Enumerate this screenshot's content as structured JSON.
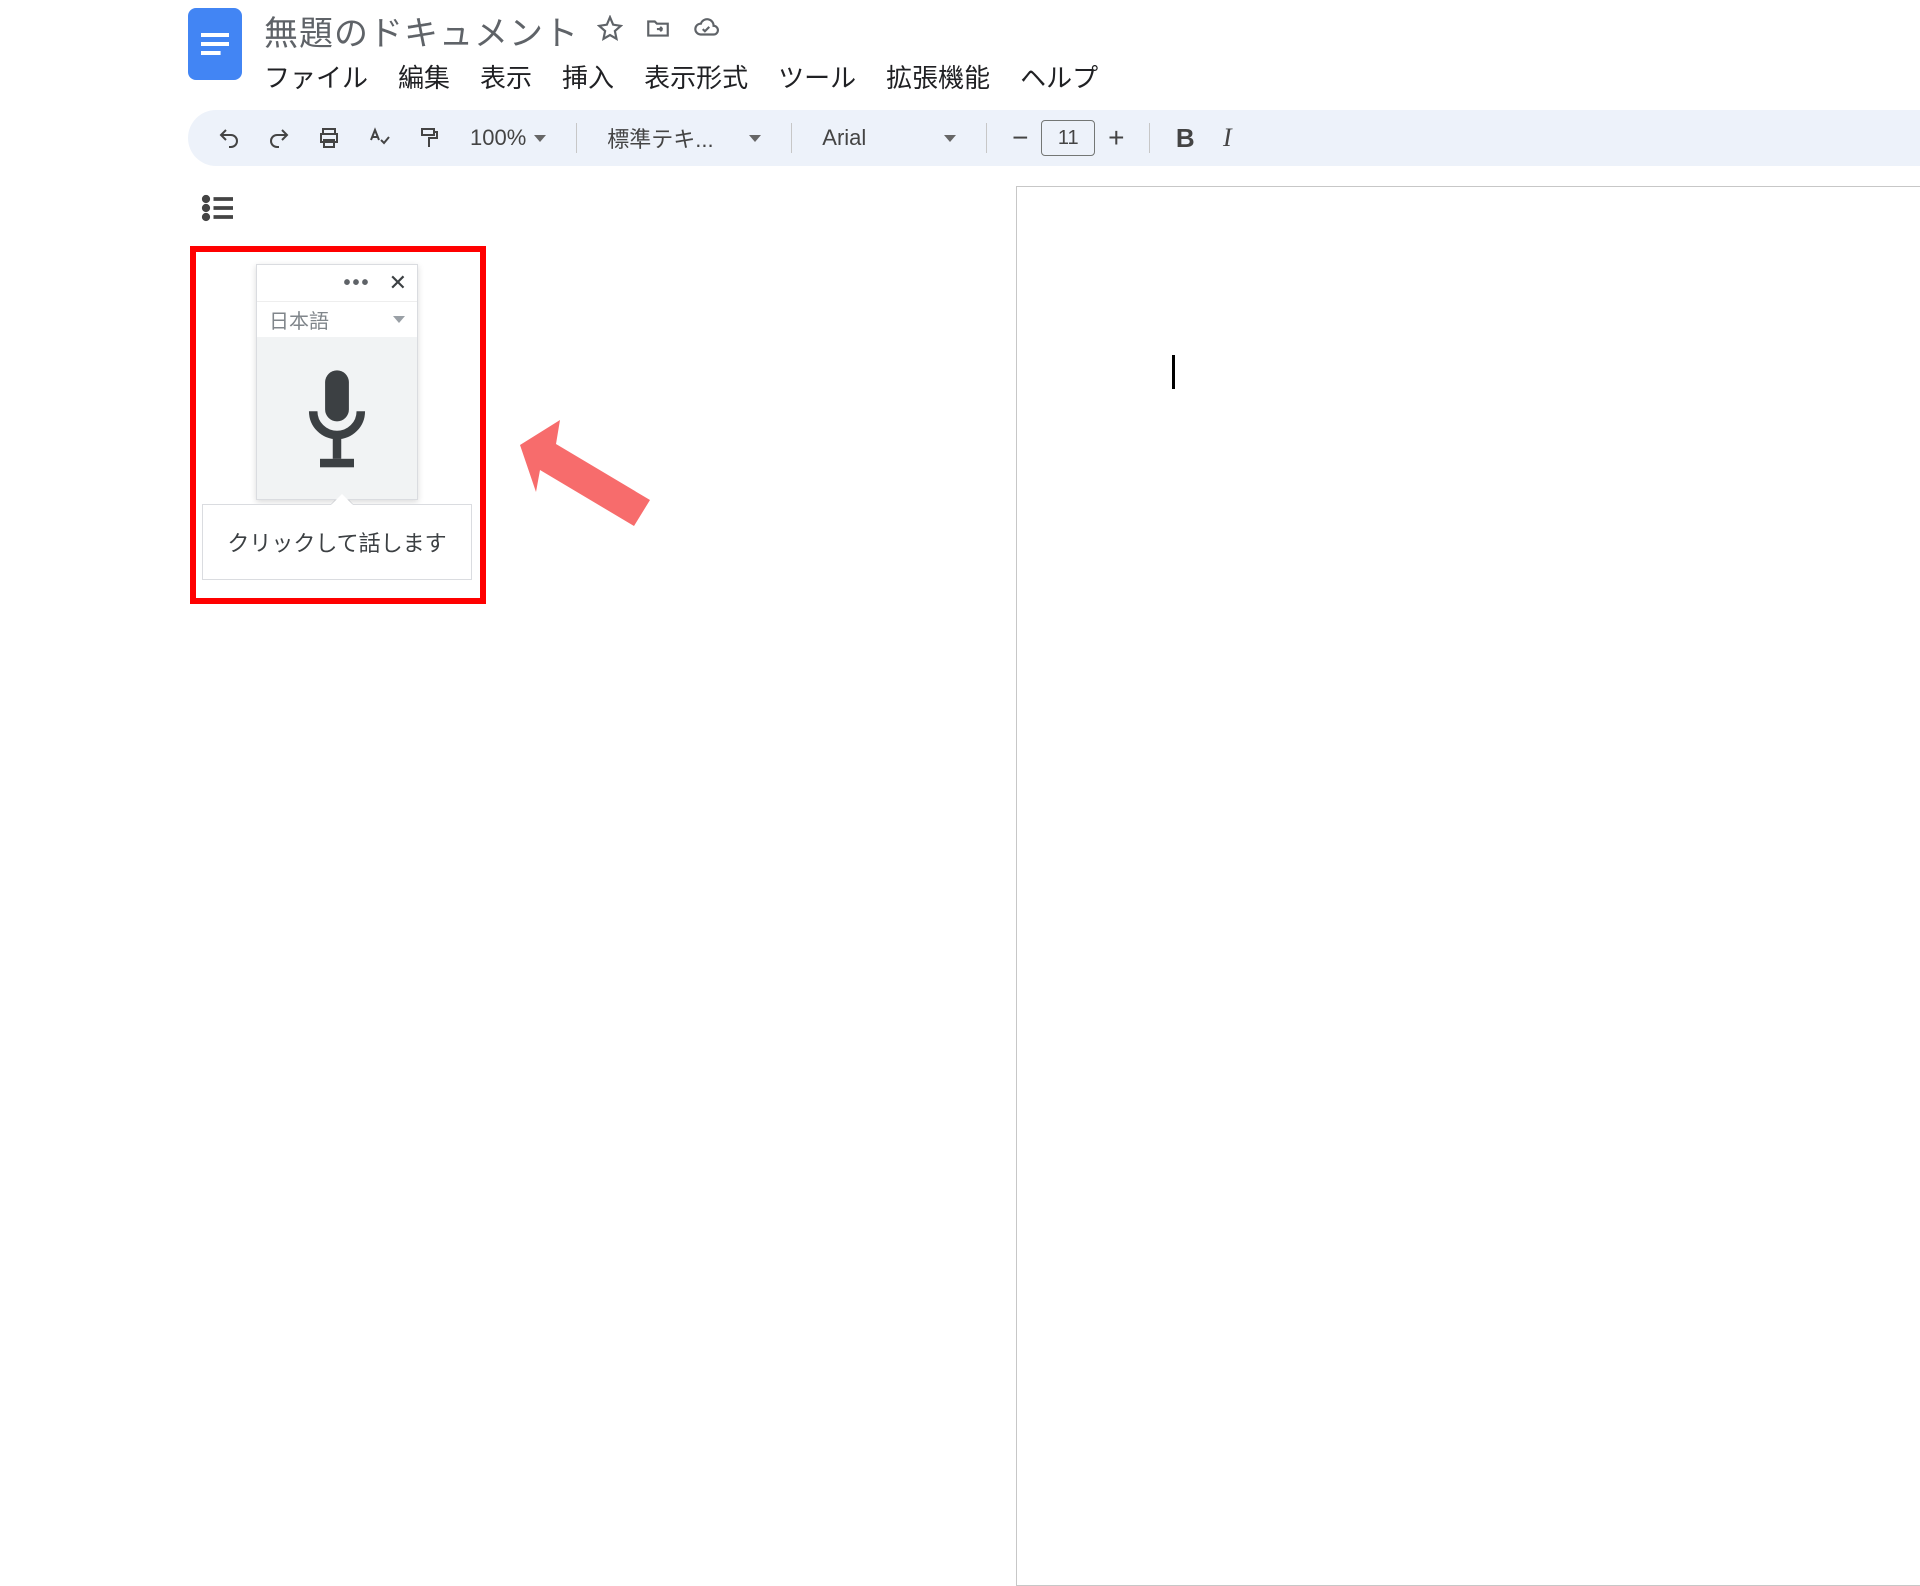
{
  "header": {
    "title": "無題のドキュメント",
    "icons": {
      "star": "star-icon",
      "move": "folder-move-icon",
      "cloud": "cloud-saved-icon"
    }
  },
  "menus": [
    "ファイル",
    "編集",
    "表示",
    "挿入",
    "表示形式",
    "ツール",
    "拡張機能",
    "ヘルプ"
  ],
  "toolbar": {
    "zoom": "100%",
    "style": "標準テキ...",
    "font": "Arial",
    "font_size": "11",
    "minus": "−",
    "plus": "+",
    "bold": "B",
    "italic": "I"
  },
  "voice": {
    "language": "日本語",
    "tooltip": "クリックして話します",
    "more": "•••",
    "close": "✕"
  }
}
